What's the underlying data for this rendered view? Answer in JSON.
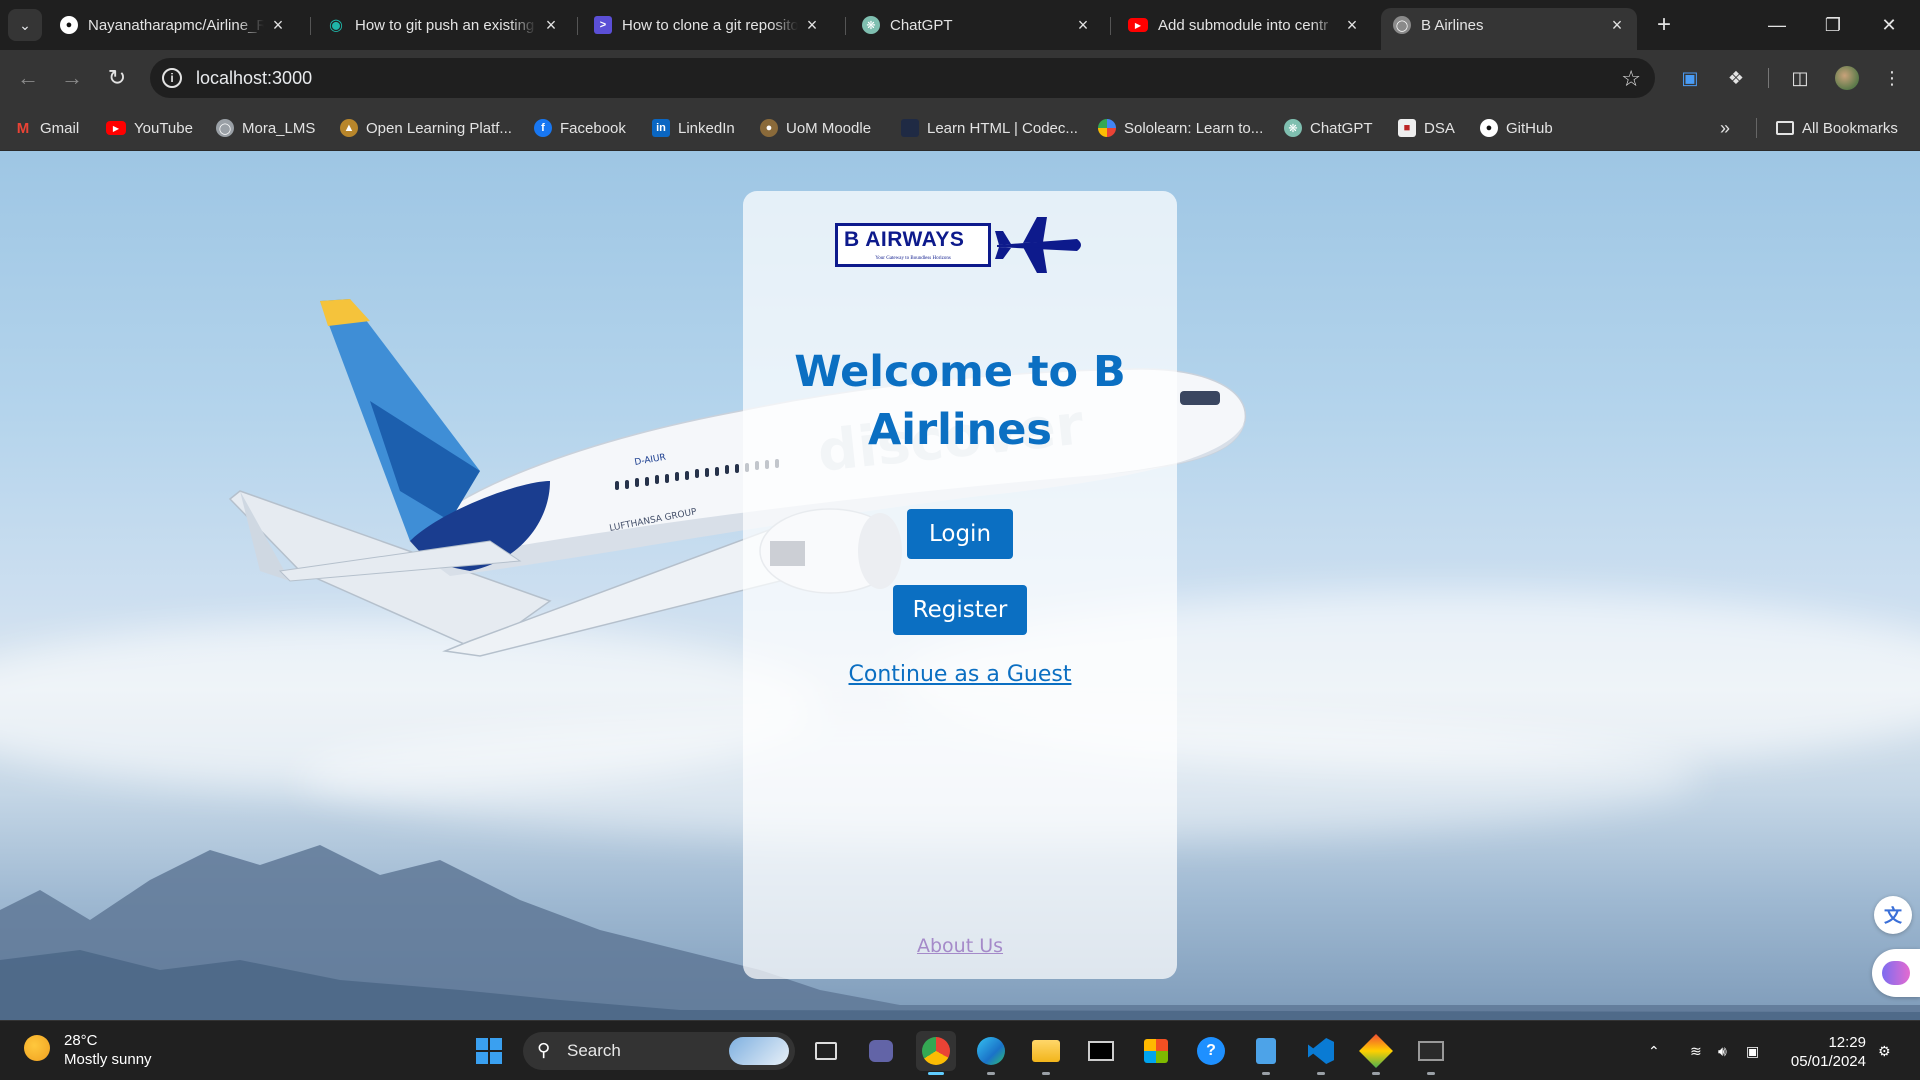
{
  "browser": {
    "tabs": [
      {
        "title": "Nayanatharapmc/Airline_R",
        "icon": "github-icon"
      },
      {
        "title": "How to git push an existing",
        "icon": "eye-icon"
      },
      {
        "title": "How to clone a git reposito",
        "icon": "terminal-icon"
      },
      {
        "title": "ChatGPT",
        "icon": "chatgpt-icon"
      },
      {
        "title": "Add submodule into centr",
        "icon": "youtube-icon"
      },
      {
        "title": "B Airlines",
        "icon": "globe-icon",
        "active": true
      }
    ],
    "url": "localhost:3000",
    "bookmarks": [
      {
        "label": "Gmail",
        "icon": "gmail-icon"
      },
      {
        "label": "YouTube",
        "icon": "youtube-icon"
      },
      {
        "label": "Mora_LMS",
        "icon": "globe-icon"
      },
      {
        "label": "Open Learning Platf...",
        "icon": "open-learning-icon"
      },
      {
        "label": "Facebook",
        "icon": "facebook-icon"
      },
      {
        "label": "LinkedIn",
        "icon": "linkedin-icon"
      },
      {
        "label": "UoM Moodle",
        "icon": "moodle-icon"
      },
      {
        "label": "Learn HTML | Codec...",
        "icon": "codecademy-icon"
      },
      {
        "label": "Sololearn: Learn to...",
        "icon": "sololearn-icon"
      },
      {
        "label": "ChatGPT",
        "icon": "chatgpt-icon"
      },
      {
        "label": "DSA",
        "icon": "dsa-icon"
      },
      {
        "label": "GitHub",
        "icon": "github-icon"
      }
    ],
    "all_bookmarks_label": "All Bookmarks"
  },
  "page": {
    "logo_text": "B AIRWAYS",
    "logo_tagline": "Your Gateway to Boundless Horizons",
    "welcome_title": "Welcome to B Airlines",
    "login_label": "Login",
    "register_label": "Register",
    "guest_label": "Continue as a Guest",
    "about_label": "About Us",
    "plane_livery": "discover",
    "plane_registration": "D-AIUR",
    "plane_group_text": "LUFTHANSA GROUP"
  },
  "taskbar": {
    "weather_temp": "28°C",
    "weather_desc": "Mostly sunny",
    "search_placeholder": "Search",
    "time": "12:29",
    "date": "05/01/2024"
  },
  "colors": {
    "brand_blue": "#0b6fc2",
    "logo_navy": "#0d1a8c",
    "about_link": "#a58ac9"
  }
}
